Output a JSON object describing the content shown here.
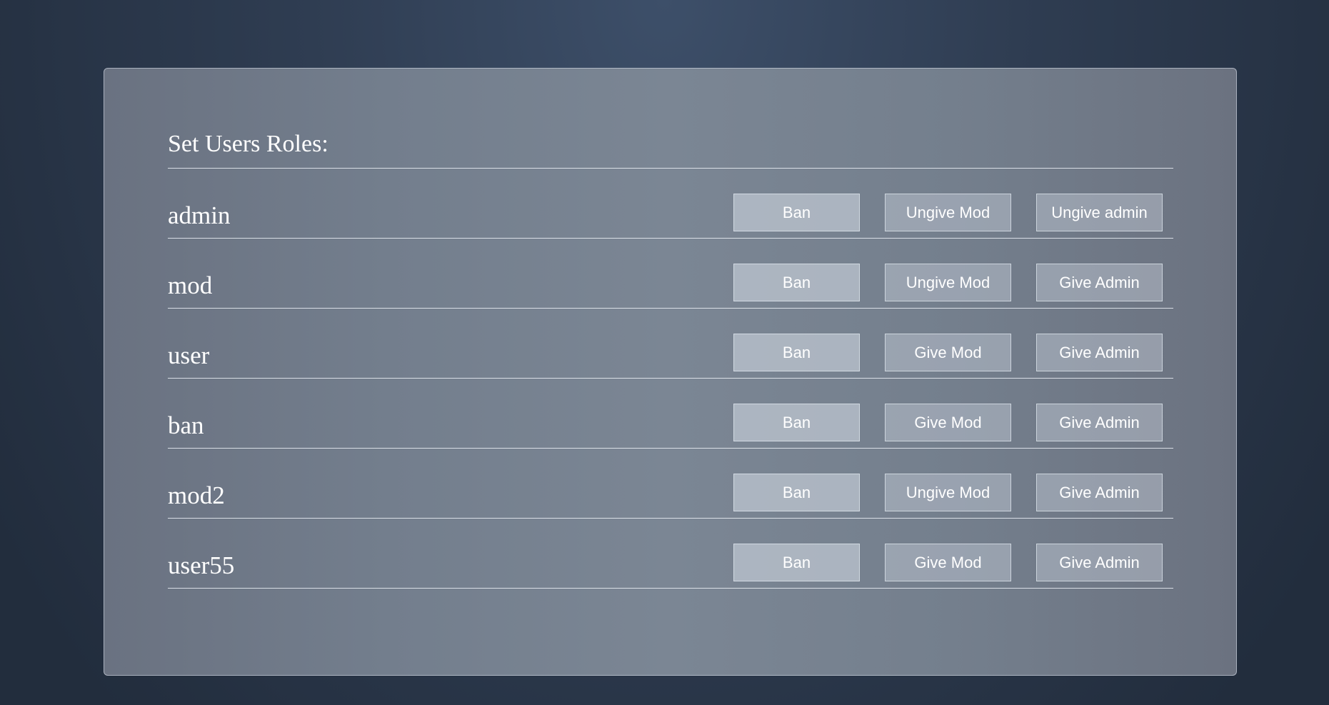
{
  "page": {
    "title": "Set Users Roles:"
  },
  "users": [
    {
      "name": "admin",
      "actions": [
        "Ban",
        "Ungive Mod",
        "Ungive admin"
      ]
    },
    {
      "name": "mod",
      "actions": [
        "Ban",
        "Ungive Mod",
        "Give Admin"
      ]
    },
    {
      "name": "user",
      "actions": [
        "Ban",
        "Give Mod",
        "Give Admin"
      ]
    },
    {
      "name": "ban",
      "actions": [
        "Ban",
        "Give Mod",
        "Give Admin"
      ]
    },
    {
      "name": "mod2",
      "actions": [
        "Ban",
        "Ungive Mod",
        "Give Admin"
      ]
    },
    {
      "name": "user55",
      "actions": [
        "Ban",
        "Give Mod",
        "Give Admin"
      ]
    }
  ],
  "colors": {
    "background_center": "#3d4f69",
    "background_edge": "#222d3d",
    "panel": "#7b8694",
    "text": "#ffffff"
  }
}
